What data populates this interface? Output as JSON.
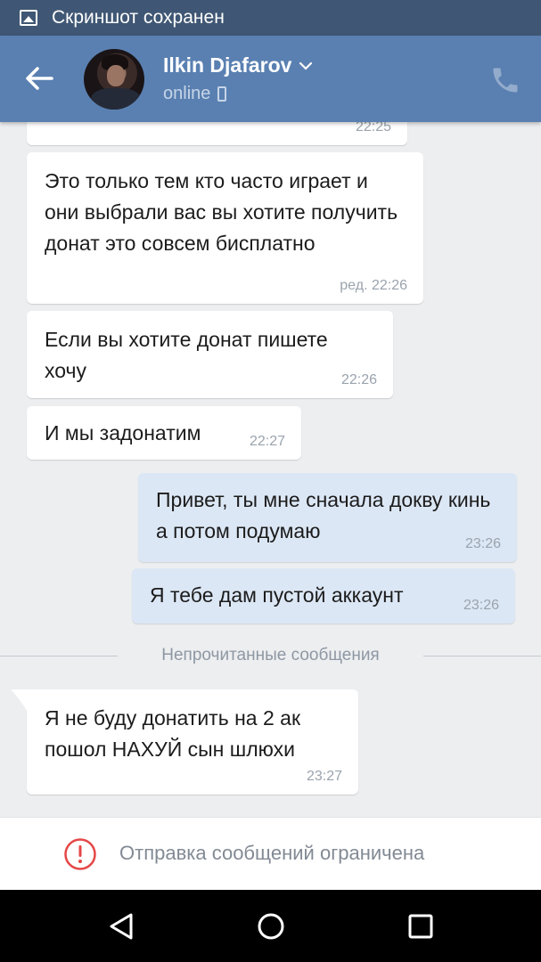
{
  "status_bar": {
    "notification_text": "Скриншот сохранен",
    "icon": "image-icon"
  },
  "header": {
    "contact_name": "Ilkin Djafarov",
    "status": "online",
    "icons": {
      "back": "arrow-left-icon",
      "dropdown": "chevron-down-icon",
      "device": "mobile-icon",
      "call": "phone-icon"
    }
  },
  "messages": [
    {
      "direction": "in",
      "text": "",
      "time": "22:25",
      "partial": true
    },
    {
      "direction": "in",
      "text": "Это только тем кто часто играет и они выбрали вас вы хотите получить донат это совсем бисплатно",
      "time": "ред. 22:26"
    },
    {
      "direction": "in",
      "text": "Если вы хотите донат пишете хочу",
      "time": "22:26"
    },
    {
      "direction": "in",
      "text": "И мы задонатим",
      "time": "22:27"
    },
    {
      "direction": "out",
      "text": "Привет, ты мне сначала докву кинь а потом подумаю",
      "time": "23:26"
    },
    {
      "direction": "out",
      "text": "Я тебе дам пустой аккаунт",
      "time": "23:26"
    },
    {
      "direction": "in",
      "text": "Я не буду донатить на 2 ак пошол НАХУЙ сын шлюхи",
      "time": "23:27"
    }
  ],
  "unread_divider": "Непрочитанные сообщения",
  "restriction": {
    "text": "Отправка сообщений ограничена",
    "icon": "warning-circle-icon",
    "color": "#e64646"
  },
  "navigation": {
    "back": "nav-back-icon",
    "home": "nav-home-icon",
    "recents": "nav-recents-icon"
  },
  "colors": {
    "header": "#5a80b1",
    "status_bar": "#3f5774",
    "background": "#edeef0",
    "outgoing_bubble": "#dce7f5",
    "incoming_bubble": "#ffffff"
  }
}
